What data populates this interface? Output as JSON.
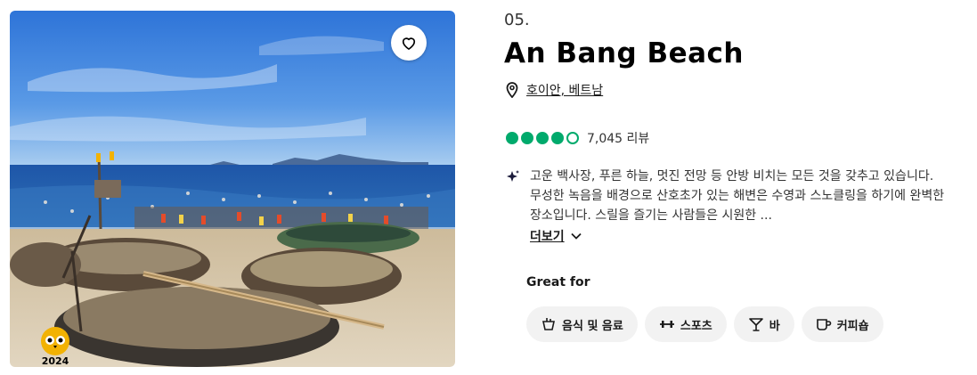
{
  "card": {
    "rank": "05.",
    "title": "An Bang Beach",
    "location": "호이안, 베트남",
    "rating": {
      "value": 4,
      "max": 5,
      "reviews": "7,045 리뷰"
    },
    "description": "고운 백사장, 푸른 하늘, 멋진 전망 등 안방 비치는 모든 것을 갖추고 있습니다. 무성한 녹음을 배경으로 산호초가 있는 해변은 수영과 스노클링을 하기에 완벽한 장소입니다. 스릴을 즐기는 사람들은 시원한 ...",
    "more_label": "더보기",
    "badge_year": "2024",
    "great_for_label": "Great for",
    "tags": [
      {
        "label": "음식 및 음료",
        "icon": "food-icon"
      },
      {
        "label": "스포츠",
        "icon": "dumbbell-icon"
      },
      {
        "label": "바",
        "icon": "cocktail-icon"
      },
      {
        "label": "커피숍",
        "icon": "coffee-icon"
      }
    ]
  },
  "colors": {
    "rating": "#00aa6c",
    "chip_bg": "#f2f2f2",
    "badge": "#f2b203"
  }
}
